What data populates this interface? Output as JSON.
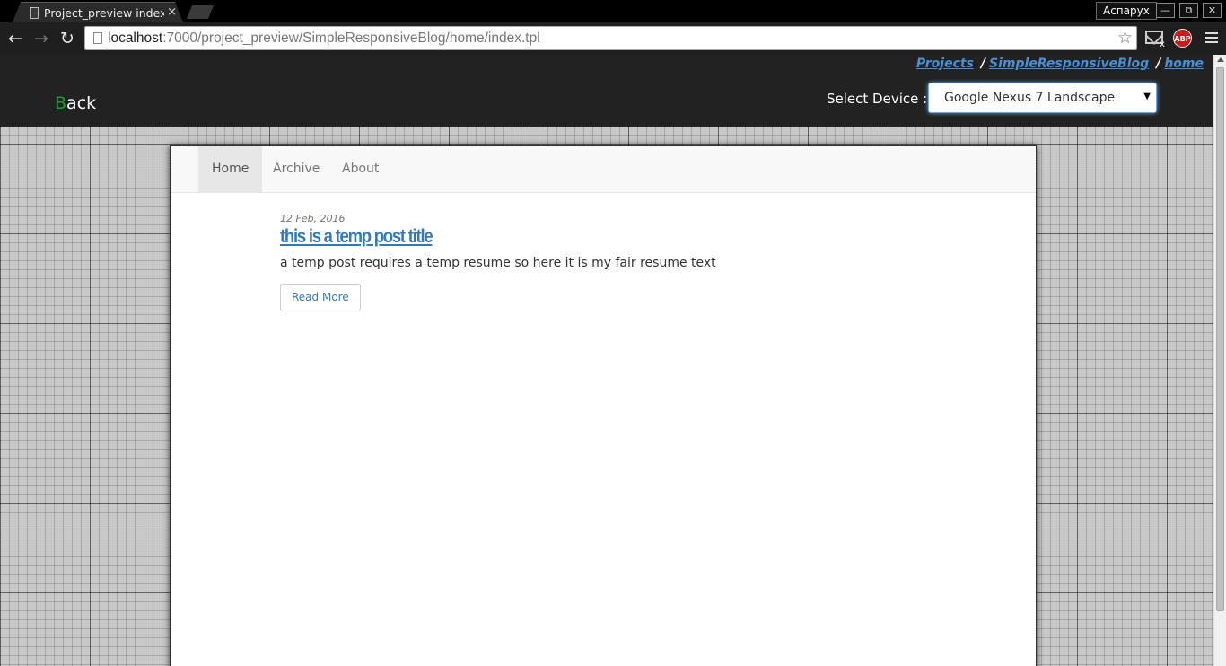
{
  "browser": {
    "tab_title": "Project_preview index.tpl",
    "tab_close": "×",
    "user_name": "Аспарух",
    "window_buttons": {
      "minimize": "—",
      "restore": "⧉",
      "close": "✕"
    },
    "url_host": "localhost",
    "url_rest": ":7000/project_preview/SimpleResponsiveBlog/home/index.tpl",
    "icons": {
      "back": "←",
      "forward": "→",
      "reload": "↻",
      "star": "☆"
    },
    "extensions": {
      "mail_badge": "x",
      "abp_label": "ABP"
    }
  },
  "header": {
    "breadcrumb": [
      "Projects",
      "SimpleResponsiveBlog",
      "home"
    ],
    "breadcrumb_separator": "/",
    "back_first_letter": "B",
    "back_rest": "ack",
    "device_label": "Select Device :",
    "device_selected": "Google Nexus 7 Landscape",
    "select_arrow": "▼"
  },
  "blog": {
    "nav": [
      "Home",
      "Archive",
      "About"
    ],
    "active_nav": "Home",
    "post": {
      "date": "12 Feb, 2016",
      "title": "this is a temp post title",
      "resume": "a temp post requires a temp resume so here it is my fair resume text",
      "read_more": "Read More"
    }
  },
  "colors": {
    "header_bg": "#222222",
    "link_blue": "#337ab7",
    "back_green": "#1e9c2c",
    "grid_bg": "#c8c8c8"
  }
}
